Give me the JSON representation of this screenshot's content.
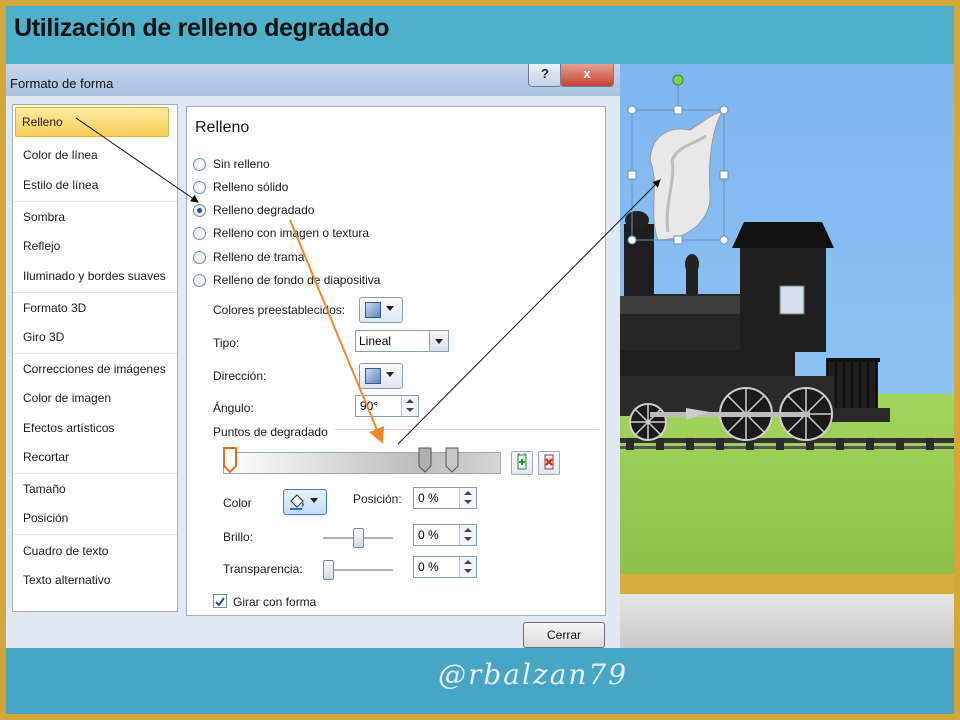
{
  "slide": {
    "title": "Utilización de relleno degradado",
    "footer_handle": "@rbalzan79"
  },
  "dialog": {
    "title": "Formato de forma",
    "help_label": "?",
    "close_label": "x",
    "sidebar": [
      {
        "label": "Relleno",
        "selected": true
      },
      {
        "label": "Color de línea"
      },
      {
        "label": "Estilo de línea"
      },
      {
        "label": "Sombra"
      },
      {
        "label": "Reflejo"
      },
      {
        "label": "Iluminado y bordes suaves"
      },
      {
        "label": "Formato 3D"
      },
      {
        "label": "Giro 3D"
      },
      {
        "label": "Correcciones de imágenes"
      },
      {
        "label": "Color de imagen"
      },
      {
        "label": "Efectos artísticos"
      },
      {
        "label": "Recortar"
      },
      {
        "label": "Tamaño"
      },
      {
        "label": "Posición"
      },
      {
        "label": "Cuadro de texto"
      },
      {
        "label": "Texto alternativo"
      }
    ],
    "panel": {
      "title": "Relleno",
      "options": [
        {
          "label": "Sin relleno",
          "checked": false
        },
        {
          "label": "Relleno sólido",
          "checked": false
        },
        {
          "label": "Relleno degradado",
          "checked": true
        },
        {
          "label": "Relleno con imagen o textura",
          "checked": false
        },
        {
          "label": "Relleno de trama",
          "checked": false
        },
        {
          "label": "Relleno de fondo de diapositiva",
          "checked": false
        }
      ],
      "preset_colors_label": "Colores preestablecidos:",
      "type_label": "Tipo:",
      "type_value": "Lineal",
      "direction_label": "Dirección:",
      "angle_label": "Ángulo:",
      "angle_value": "90°",
      "stops_label": "Puntos de degradado",
      "color_label": "Color",
      "position_label": "Posición:",
      "position_value": "0 %",
      "brightness_label": "Brillo:",
      "brightness_value": "0 %",
      "transparency_label": "Transparencia:",
      "transparency_value": "0 %",
      "rotate_label": "Girar con forma",
      "rotate_checked": true
    },
    "close_button": "Cerrar"
  },
  "colors": {
    "frame": "#d4a73a",
    "slide_bg": "#3ba3c2",
    "arrow_orange": "#f0872a",
    "selected_tab": "#f8cf5a"
  }
}
